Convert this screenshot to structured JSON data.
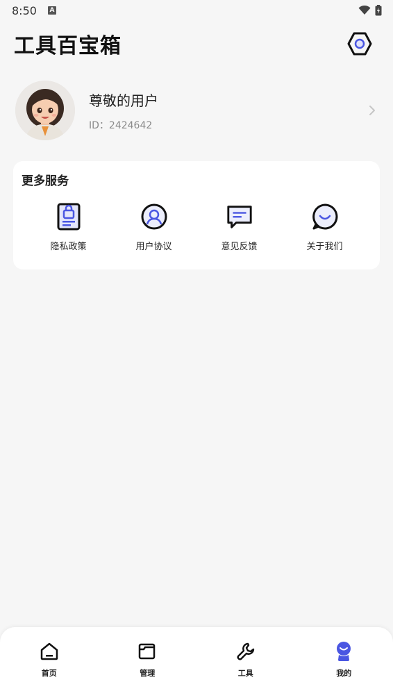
{
  "status_bar": {
    "time": "8:50",
    "notification_icon": "a-icon",
    "wifi_icon": "wifi-icon",
    "battery_icon": "battery-icon"
  },
  "header": {
    "title": "工具百宝箱",
    "settings_icon": "hexagon-settings-icon"
  },
  "profile": {
    "name": "尊敬的用户",
    "id_text": "ID：2424642",
    "avatar_icon": "avatar-girl",
    "chevron_icon": "chevron-right-icon"
  },
  "services": {
    "title": "更多服务",
    "items": [
      {
        "label": "隐私政策",
        "icon": "privacy-lock-icon"
      },
      {
        "label": "用户协议",
        "icon": "user-agreement-icon"
      },
      {
        "label": "意见反馈",
        "icon": "feedback-icon"
      },
      {
        "label": "关于我们",
        "icon": "about-chat-icon"
      }
    ]
  },
  "tabs": [
    {
      "label": "首页",
      "icon": "home-icon",
      "active": false
    },
    {
      "label": "管理",
      "icon": "folder-icon",
      "active": false
    },
    {
      "label": "工具",
      "icon": "wrench-icon",
      "active": false
    },
    {
      "label": "我的",
      "icon": "profile-icon",
      "active": true
    }
  ],
  "colors": {
    "accent": "#4a56e2",
    "background": "#f6f6f6",
    "card": "#ffffff"
  }
}
